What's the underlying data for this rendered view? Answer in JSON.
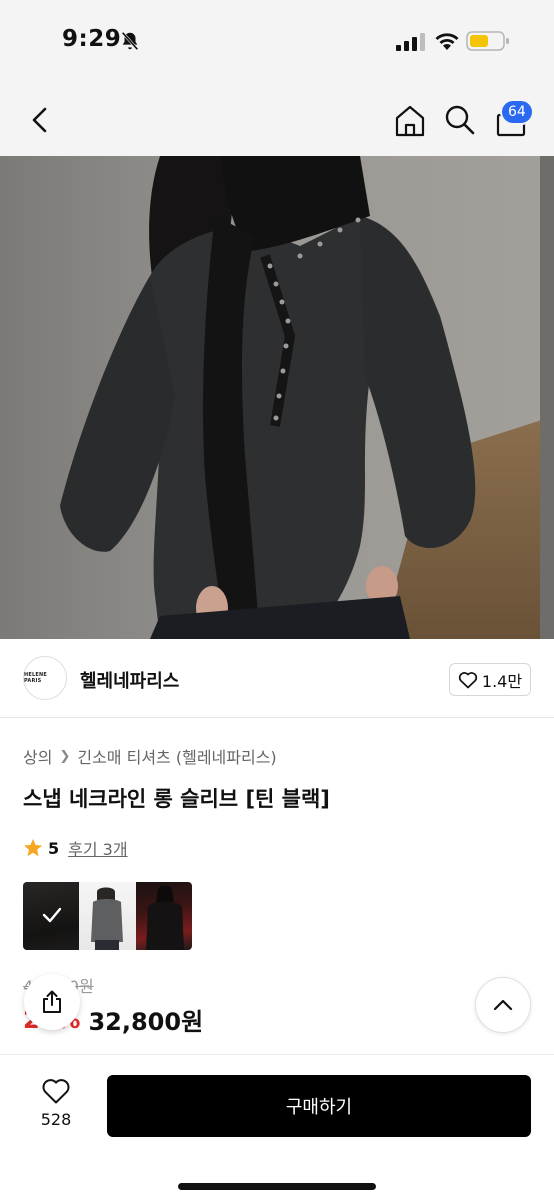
{
  "status_bar": {
    "time": "9:29"
  },
  "nav": {
    "cart_badge": "64"
  },
  "seller": {
    "logo_text": "HELENE PARIS",
    "name": "헬레네파리스",
    "like_count": "1.4만"
  },
  "breadcrumb": {
    "category": "상의",
    "subcategory": "긴소매 티셔츠 (헬레네파리스)"
  },
  "product": {
    "title": "스냅 네크라인 롱 슬리브 [틴 블랙]",
    "rating": "5",
    "review_link": "후기 3개",
    "original_price": "41,000원",
    "discount_rate": "20%",
    "sale_price": "32,800원"
  },
  "bottom_bar": {
    "wish_count": "528",
    "buy_label": "구매하기"
  },
  "colors": {
    "accent": "#2b6af0",
    "sale": "#e12a2a",
    "star": "#f5a623",
    "buy_button": "#000000"
  }
}
